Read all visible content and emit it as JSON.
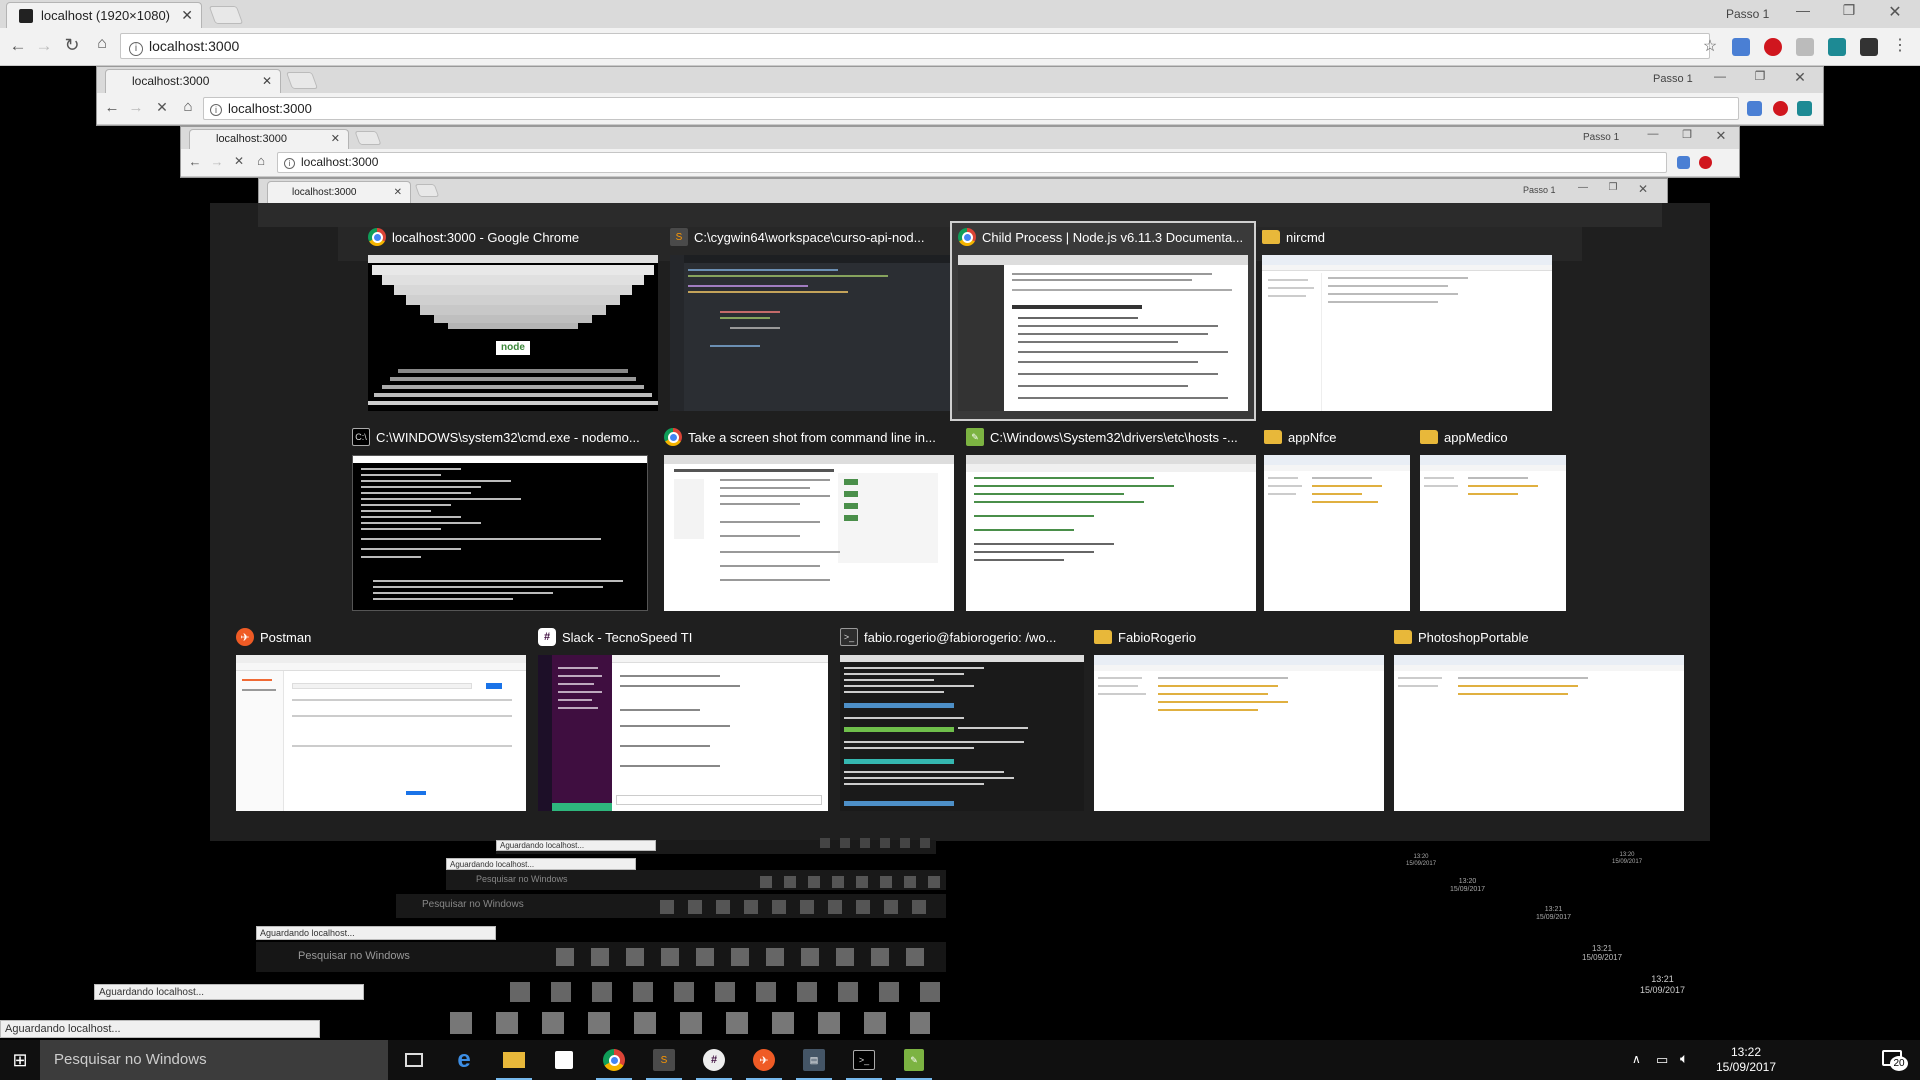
{
  "browser": {
    "tab_title": "localhost (1920×1080)",
    "profile": "Passo 1",
    "url": "localhost:3000",
    "nested_tab_title": "localhost:3000"
  },
  "switcher": {
    "items": [
      {
        "title": "localhost:3000 - Google Chrome",
        "icon": "chrome-icon",
        "selected": false
      },
      {
        "title": "C:\\cygwin64\\workspace\\curso-api-nod...",
        "icon": "sublime-icon",
        "selected": false
      },
      {
        "title": "Child Process | Node.js v6.11.3 Documenta...",
        "icon": "chrome-icon",
        "selected": true
      },
      {
        "title": "nircmd",
        "icon": "folder-icon",
        "selected": false
      },
      {
        "title": "C:\\WINDOWS\\system32\\cmd.exe - nodemo...",
        "icon": "cmd-icon",
        "selected": false
      },
      {
        "title": "Take a screen shot from command line in...",
        "icon": "chrome-icon",
        "selected": false
      },
      {
        "title": "C:\\Windows\\System32\\drivers\\etc\\hosts -...",
        "icon": "notepad-icon",
        "selected": false
      },
      {
        "title": "appNfce",
        "icon": "folder-icon",
        "selected": false
      },
      {
        "title": "appMedico",
        "icon": "folder-icon",
        "selected": false
      },
      {
        "title": "Postman",
        "icon": "postman-icon",
        "selected": false
      },
      {
        "title": "Slack - TecnoSpeed TI",
        "icon": "slack-icon",
        "selected": false
      },
      {
        "title": "fabio.rogerio@fabiorogerio: /wo...",
        "icon": "terminal-icon",
        "selected": false
      },
      {
        "title": "FabioRogerio",
        "icon": "folder-icon",
        "selected": false
      },
      {
        "title": "PhotoshopPortable",
        "icon": "folder-icon",
        "selected": false
      }
    ]
  },
  "thumb_text": {
    "node_logo": "node"
  },
  "taskbar": {
    "search_placeholder": "Pesquisar no Windows",
    "time": "13:22",
    "date": "15/09/2017",
    "notifications": "20",
    "apps": [
      "task-view-icon",
      "edge-icon",
      "file-explorer-icon",
      "store-icon",
      "chrome-icon",
      "sublime-icon",
      "slack-icon",
      "postman-icon",
      "notepad-icon",
      "cmd-icon",
      "notepad-plus-icon"
    ]
  },
  "ghost_taskbars": {
    "search_placeholder": "Pesquisar no Windows",
    "status": "Aguardando localhost...",
    "times": [
      "13:21",
      "13:21",
      "13:20",
      "13:20"
    ],
    "date": "15/09/2017",
    "notifications": "20"
  },
  "status_bar": "Aguardando localhost...",
  "colors": {
    "switcher_bg": "#1f1f1f",
    "taskbar_bg": "#101010",
    "selected_outline": "#d0d0d0",
    "accent": "#76b9ed"
  }
}
